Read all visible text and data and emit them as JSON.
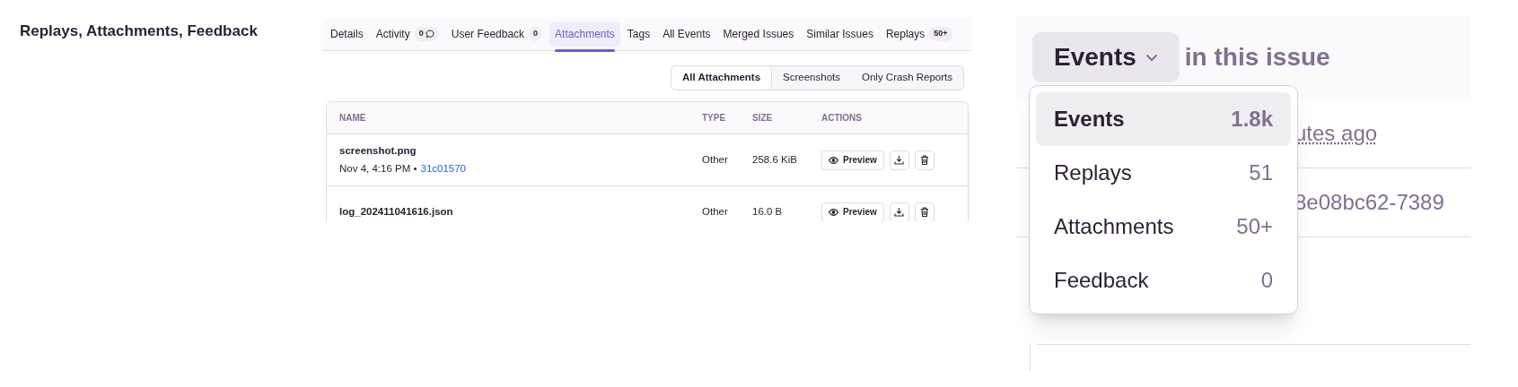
{
  "section_title": "Replays, Attachments, Feedback",
  "tabs": [
    {
      "label": "Details",
      "selected": false
    },
    {
      "label": "Activity",
      "selected": false,
      "badge": "0",
      "comment_icon": true
    },
    {
      "label": "User Feedback",
      "selected": false,
      "badge": "0"
    },
    {
      "label": "Attachments",
      "selected": true
    },
    {
      "label": "Tags",
      "selected": false
    },
    {
      "label": "All Events",
      "selected": false
    },
    {
      "label": "Merged Issues",
      "selected": false
    },
    {
      "label": "Similar Issues",
      "selected": false
    },
    {
      "label": "Replays",
      "selected": false,
      "badge": "50+"
    }
  ],
  "filters": [
    {
      "label": "All Attachments",
      "selected": true
    },
    {
      "label": "Screenshots",
      "selected": false
    },
    {
      "label": "Only Crash Reports",
      "selected": false
    }
  ],
  "table": {
    "columns": [
      "NAME",
      "TYPE",
      "SIZE",
      "ACTIONS"
    ],
    "rows": [
      {
        "name": "screenshot.png",
        "date": "Nov 4, 4:16 PM •",
        "event": "31c01570",
        "type": "Other",
        "size": "258.6 KiB",
        "preview": "Preview"
      },
      {
        "name": "log_202411041616.json",
        "type": "Other",
        "size": "16.0 B",
        "preview": "Preview"
      }
    ]
  },
  "issue_panel": {
    "selector": "Events",
    "suffix": "in this issue",
    "background_texts": [
      "utes ago",
      "8e08bc62-7389"
    ],
    "menu": [
      {
        "label": "Events",
        "count": "1.8k",
        "selected": true
      },
      {
        "label": "Replays",
        "count": "51",
        "selected": false
      },
      {
        "label": "Attachments",
        "count": "50+",
        "selected": false
      },
      {
        "label": "Feedback",
        "count": "0",
        "selected": false
      }
    ]
  }
}
